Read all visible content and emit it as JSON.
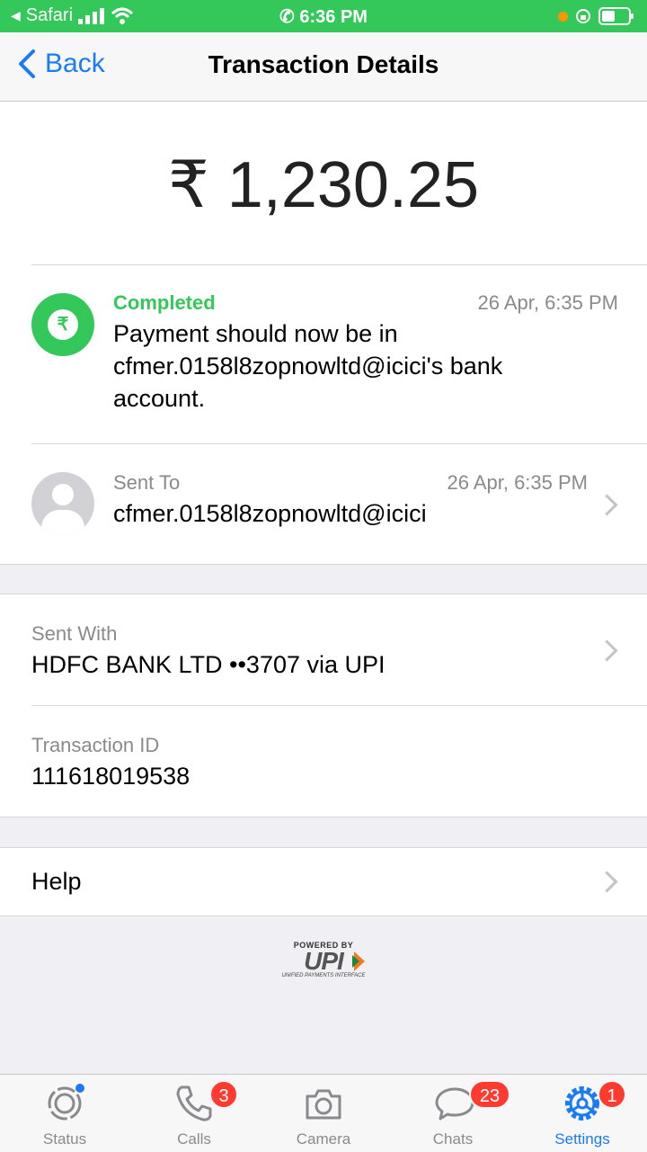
{
  "status_bar": {
    "carrier": "Safari",
    "time": "6:36 PM"
  },
  "nav": {
    "back_label": "Back",
    "title": "Transaction Details"
  },
  "transaction": {
    "amount": "₹ 1,230.25",
    "status": {
      "label": "Completed",
      "time": "26 Apr, 6:35 PM",
      "message": "Payment should now be in cfmer.0158l8zopnowltd@icici's bank account."
    },
    "sent_to": {
      "label": "Sent To",
      "time": "26 Apr, 6:35 PM",
      "value": "cfmer.0158l8zopnowltd@icici"
    }
  },
  "details": {
    "sent_with": {
      "label": "Sent With",
      "value": "HDFC BANK LTD ••3707 via UPI"
    },
    "transaction_id": {
      "label": "Transaction ID",
      "value": "111618019538"
    }
  },
  "help": {
    "label": "Help"
  },
  "upi": {
    "powered_by": "POWERED BY",
    "logo": "UPI",
    "subtitle": "UNIFIED PAYMENTS INTERFACE"
  },
  "tabs": [
    {
      "label": "Status",
      "icon": "status-icon"
    },
    {
      "label": "Calls",
      "icon": "phone-icon",
      "badge": "3"
    },
    {
      "label": "Camera",
      "icon": "camera-icon"
    },
    {
      "label": "Chats",
      "icon": "chat-icon",
      "badge": "23"
    },
    {
      "label": "Settings",
      "icon": "gear-icon",
      "badge": "1"
    }
  ],
  "colors": {
    "status_bar": "#34c759",
    "accent": "#1a7cf5",
    "completed": "#34c759",
    "badge": "#ff3b30"
  }
}
